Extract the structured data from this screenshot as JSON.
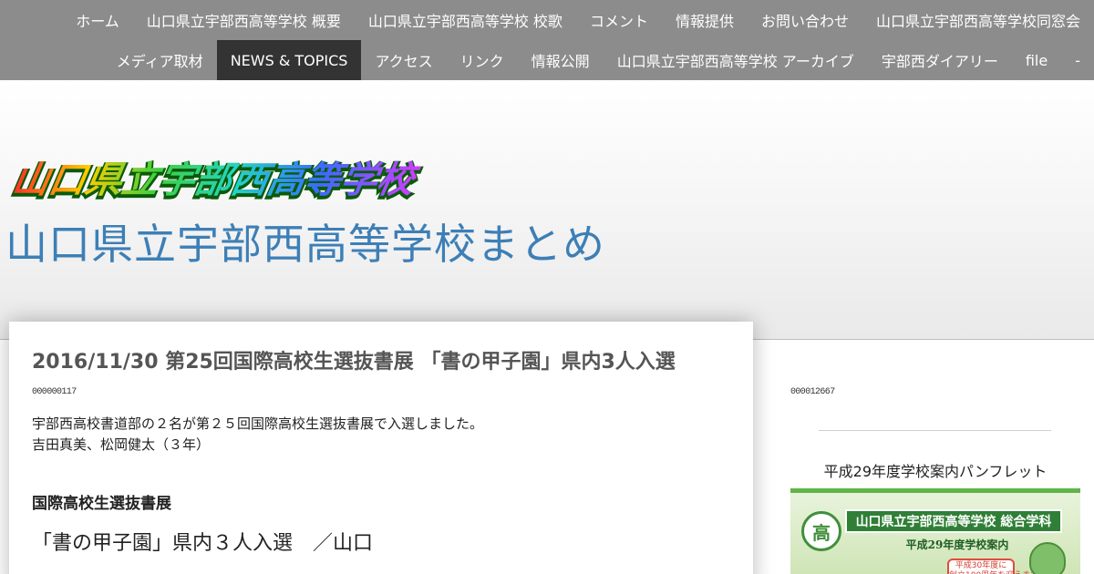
{
  "nav": {
    "row1": [
      "ホーム",
      "山口県立宇部西高等学校 概要",
      "山口県立宇部西高等学校 校歌",
      "コメント",
      "情報提供",
      "お問い合わせ",
      "山口県立宇部西高等学校同窓会"
    ],
    "row2": [
      "メディア取材",
      "NEWS & TOPICS",
      "アクセス",
      "リンク",
      "情報公開",
      "山口県立宇部西高等学校 アーカイブ",
      "宇部西ダイアリー",
      "file",
      "-"
    ],
    "active": "NEWS & TOPICS"
  },
  "header": {
    "logo_text": "山口県立宇部西高等学校",
    "site_title": "山口県立宇部西高等学校まとめ"
  },
  "post": {
    "title": "2016/11/30 第25回国際高校生選抜書展 「書の甲子園」県内3人入選",
    "counter": "000000117",
    "body_line1": "宇部西高校書道部の２名が第２５回国際高校生選抜書展で入選しました。",
    "body_line2": "吉田真美、松岡健太（３年）",
    "heading": "国際高校生選抜書展",
    "subheading": "「書の甲子園」県内３人入選　／山口"
  },
  "sidebar": {
    "counter": "000012667",
    "widget_title": "平成29年度学校案内パンフレット",
    "pamphlet": {
      "emblem": "高",
      "banner": "山口県立宇部西高等学校 総合学科",
      "sub": "平成29年度学校案内",
      "badge": "平成30年度に\n創立100周年を迎えます!"
    }
  }
}
